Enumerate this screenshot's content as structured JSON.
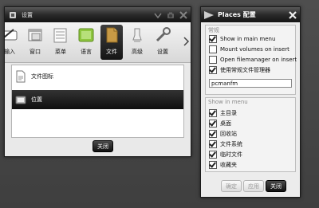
{
  "settings_window": {
    "title": "设置",
    "tabs": [
      {
        "label": "输入",
        "icon": "keyboard-icon"
      },
      {
        "label": "窗口",
        "icon": "window-icon"
      },
      {
        "label": "菜单",
        "icon": "menu-icon"
      },
      {
        "label": "语言",
        "icon": "language-icon"
      },
      {
        "label": "文件",
        "icon": "file-icon",
        "active": true
      },
      {
        "label": "高级",
        "icon": "advanced-icon"
      },
      {
        "label": "设置",
        "icon": "tools-icon"
      }
    ],
    "list_items": [
      {
        "label": "文件图标",
        "icon": "file-icon-doc",
        "selected": false
      },
      {
        "label": "位置",
        "icon": "location-icon",
        "selected": true
      }
    ],
    "close_label": "关闭"
  },
  "places_window": {
    "title": "Places 配置",
    "general_group": {
      "title": "常规",
      "options": [
        {
          "label": "Show in main menu",
          "checked": true
        },
        {
          "label": "Mount volumes on insert",
          "checked": false
        },
        {
          "label": "Open filemanager on insert",
          "checked": false
        },
        {
          "label": "使用常规文件管理器",
          "checked": true
        }
      ],
      "filemanager_value": "pcmanfm"
    },
    "menu_group": {
      "title": "Show in menu",
      "options": [
        {
          "label": "主目录",
          "checked": true
        },
        {
          "label": "桌面",
          "checked": true
        },
        {
          "label": "回收站",
          "checked": true
        },
        {
          "label": "文件系统",
          "checked": true
        },
        {
          "label": "临时文件",
          "checked": true
        },
        {
          "label": "收藏夹",
          "checked": true
        }
      ]
    },
    "buttons": {
      "ok": "确定",
      "apply": "应用",
      "close": "关闭"
    }
  }
}
